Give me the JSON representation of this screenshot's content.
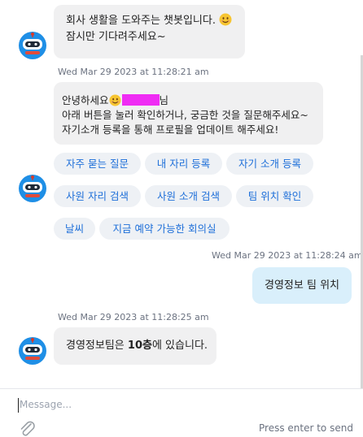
{
  "messages": {
    "bot_greeting": {
      "line1": "회사 생활을 도와주는 챗봇입니다.",
      "line2": "잠시만 기다려주세요~"
    },
    "ts1": "Wed Mar 29 2023 at 11:28:21 am",
    "bot_welcome": {
      "prefix": "안녕하세요",
      "suffix": "님",
      "line2": "아래 버튼을 눌러 확인하거나, 궁금한 것을 질문해주세요~",
      "line3": "자기소개 등록을 통해 프로필을 업데이트 해주세요!"
    },
    "quick_replies": [
      "자주 묻는 질문",
      "내 자리 등록",
      "자기 소개 등록",
      "사원 자리 검색",
      "사원 소개 검색",
      "팀 위치 확인",
      "날씨",
      "지금 예약 가능한 회의실"
    ],
    "ts2": "Wed Mar 29 2023 at 11:28:24 am",
    "user_message": "경영정보 팀 위치",
    "ts3": "Wed Mar 29 2023 at 11:28:25 am",
    "bot_answer": {
      "prefix": "경영정보팀은 ",
      "bold": "10층",
      "suffix": "에 있습니다."
    }
  },
  "composer": {
    "placeholder": "Message...",
    "hint": "Press enter to send"
  },
  "icons": {
    "avatar": "robot-avatar-icon",
    "attach": "paperclip-icon",
    "emoji": "smiling-face-emoji"
  },
  "colors": {
    "avatar_blue": "#1f8fe6",
    "chip_text": "#1e6fd9",
    "user_bubble": "#d9effb",
    "bot_bubble": "#f0f0f1",
    "redaction": "#ef2cf4"
  }
}
